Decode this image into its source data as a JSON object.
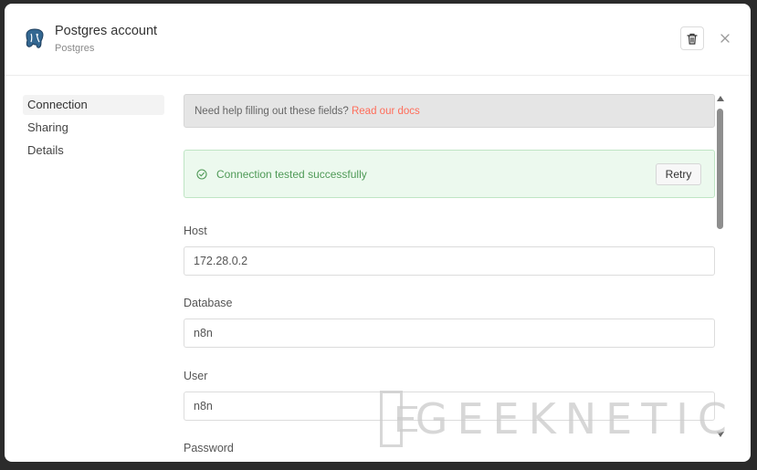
{
  "header": {
    "title": "Postgres account",
    "subtitle": "Postgres",
    "logo_icon": "postgres-elephant-icon",
    "delete_icon": "trash-icon",
    "close_icon": "close-icon"
  },
  "sidebar": {
    "items": [
      {
        "label": "Connection",
        "active": true
      },
      {
        "label": "Sharing",
        "active": false
      },
      {
        "label": "Details",
        "active": false
      }
    ]
  },
  "help": {
    "text": "Need help filling out these fields?",
    "link": "Read our docs"
  },
  "status": {
    "text": "Connection tested successfully",
    "retry_label": "Retry",
    "color": "#4f9a57"
  },
  "fields": [
    {
      "label": "Host",
      "value": "172.28.0.2"
    },
    {
      "label": "Database",
      "value": "n8n"
    },
    {
      "label": "User",
      "value": "n8n"
    },
    {
      "label": "Password",
      "value": ""
    }
  ],
  "watermark": "GEEKNETIC",
  "colors": {
    "accent": "#ff6d5a",
    "success_bg": "#ecf9ee"
  }
}
